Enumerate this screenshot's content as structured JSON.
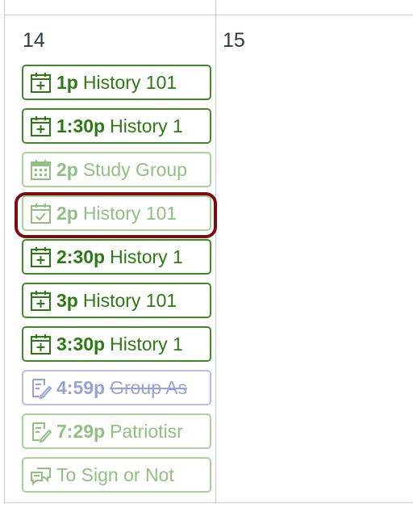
{
  "calendar": {
    "days": [
      {
        "number": "14"
      },
      {
        "number": "15"
      }
    ],
    "events": [
      {
        "time": "1p",
        "title": "History 101",
        "icon": "calendar-plus-icon",
        "style": "green"
      },
      {
        "time": "1:30p",
        "title": "History 1",
        "icon": "calendar-plus-icon",
        "style": "green"
      },
      {
        "time": "2p",
        "title": "Study Group",
        "icon": "calendar-grid-icon",
        "style": "faded"
      },
      {
        "time": "2p",
        "title": "History 101",
        "icon": "calendar-check-icon",
        "style": "faded",
        "highlighted": true
      },
      {
        "time": "2:30p",
        "title": "History 1",
        "icon": "calendar-plus-icon",
        "style": "green"
      },
      {
        "time": "3p",
        "title": "History 101",
        "icon": "calendar-plus-icon",
        "style": "green"
      },
      {
        "time": "3:30p",
        "title": "History 1",
        "icon": "calendar-plus-icon",
        "style": "green"
      },
      {
        "time": "4:59p",
        "title": "Group As",
        "icon": "assignment-icon",
        "style": "faded-blue",
        "strikethrough": true
      },
      {
        "time": "7:29p",
        "title": "Patriotisr",
        "icon": "assignment-icon",
        "style": "faded"
      },
      {
        "time": "",
        "title": "To Sign or Not",
        "icon": "discussion-icon",
        "style": "faded"
      }
    ]
  },
  "colors": {
    "course_green": "#2b7a14",
    "faded_green": "#8fbf81",
    "faded_blue": "#97a3d6",
    "highlight": "#7a0c12"
  }
}
